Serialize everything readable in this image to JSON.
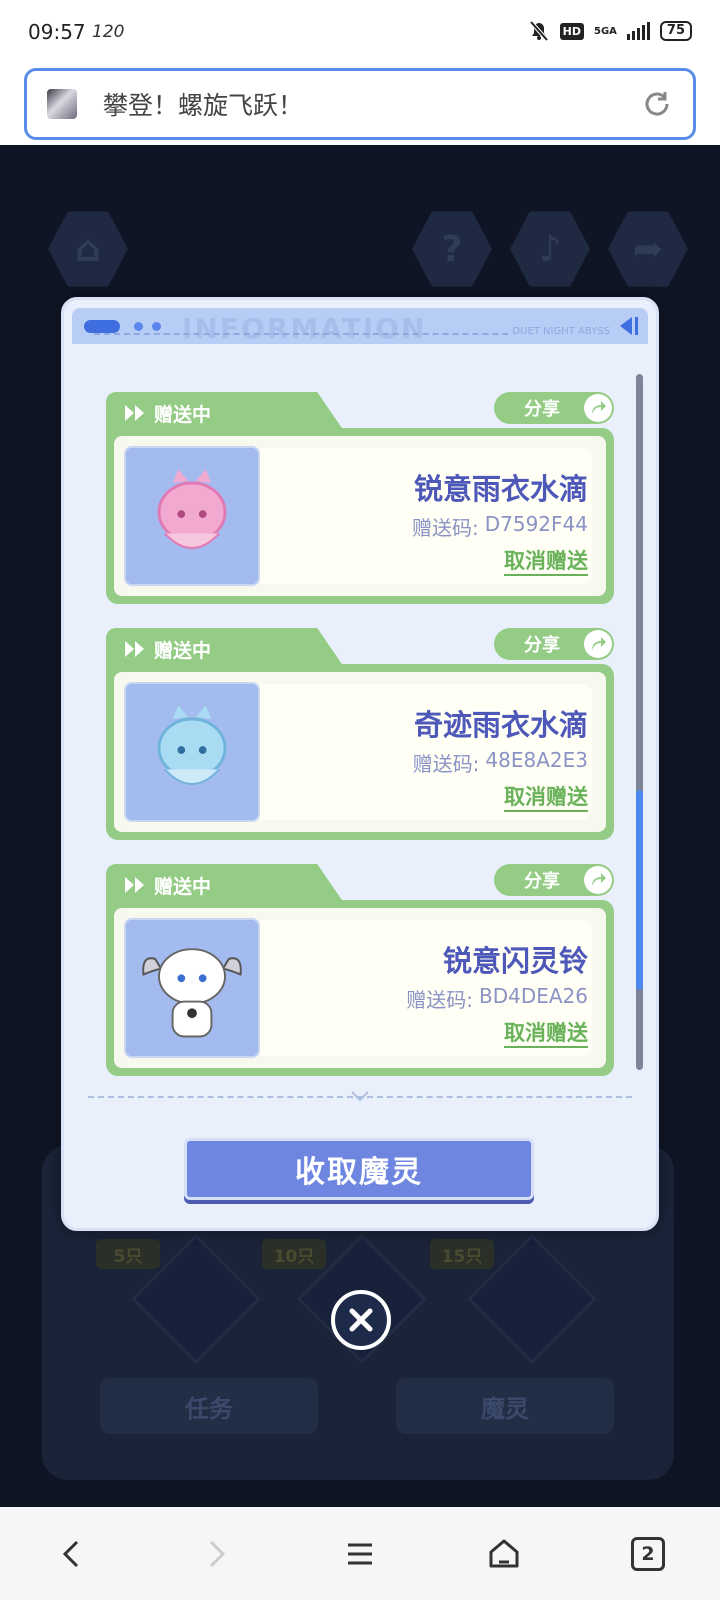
{
  "status_bar": {
    "time": "09:57",
    "refresh_rate": "120",
    "network": "5GA",
    "battery": "75"
  },
  "address_bar": {
    "title": "攀登！螺旋飞跃！"
  },
  "background": {
    "milestones": [
      "5只",
      "10只",
      "15只"
    ],
    "tabs": {
      "task": "任务",
      "spirit": "魔灵"
    }
  },
  "modal": {
    "header_watermark": "INFORMATION",
    "header_brand": "DUET NIGHT ABYSS",
    "items": [
      {
        "status": "赠送中",
        "share_label": "分享",
        "name": "锐意雨衣水滴",
        "code_label": "赠送码:",
        "code": "D7592F44",
        "cancel_label": "取消赠送",
        "thumb_color": "#f2a9d0"
      },
      {
        "status": "赠送中",
        "share_label": "分享",
        "name": "奇迹雨衣水滴",
        "code_label": "赠送码:",
        "code": "48E8A2E3",
        "cancel_label": "取消赠送",
        "thumb_color": "#a9dcf2"
      },
      {
        "status": "赠送中",
        "share_label": "分享",
        "name": "锐意闪灵铃",
        "code_label": "赠送码:",
        "code": "BD4DEA26",
        "cancel_label": "取消赠送",
        "thumb_color": "#ffffff"
      }
    ],
    "collect_button": "收取魔灵"
  },
  "nav_bar": {
    "tab_count": "2"
  },
  "colors": {
    "accent_green": "#94cc86",
    "item_name": "#4d58b8",
    "collect_button": "#6f86e0",
    "address_border": "#5a8de8"
  }
}
